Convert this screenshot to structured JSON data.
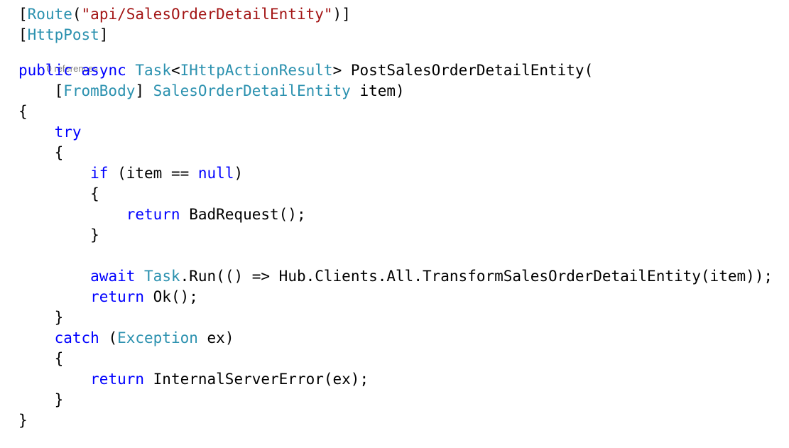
{
  "editor": {
    "language": "csharp",
    "theme": "visual-studio-light",
    "background": "#FFFFFF",
    "colors": {
      "keyword": "#0000FF",
      "type": "#2B91AF",
      "string": "#A31515",
      "plain": "#000000",
      "codelens": "#808080"
    }
  },
  "codelens": {
    "references_label": "0 references"
  },
  "code": {
    "lines": [
      {
        "id": "l1",
        "text": "[Route(\"api/SalesOrderDetailEntity\")]"
      },
      {
        "id": "l2",
        "text": "[HttpPost]"
      },
      {
        "id": "l3",
        "text": "0 references"
      },
      {
        "id": "l4",
        "text": "public async Task<IHttpActionResult> PostSalesOrderDetailEntity("
      },
      {
        "id": "l5",
        "text": "    [FromBody] SalesOrderDetailEntity item)"
      },
      {
        "id": "l6",
        "text": "{"
      },
      {
        "id": "l7",
        "text": "    try"
      },
      {
        "id": "l8",
        "text": "    {"
      },
      {
        "id": "l9",
        "text": "        if (item == null)"
      },
      {
        "id": "l10",
        "text": "        {"
      },
      {
        "id": "l11",
        "text": "            return BadRequest();"
      },
      {
        "id": "l12",
        "text": "        }"
      },
      {
        "id": "l13",
        "text": ""
      },
      {
        "id": "l14",
        "text": "        await Task.Run(() => Hub.Clients.All.TransformSalesOrderDetailEntity(item));"
      },
      {
        "id": "l15",
        "text": "        return Ok();"
      },
      {
        "id": "l16",
        "text": "    }"
      },
      {
        "id": "l17",
        "text": "    catch (Exception ex)"
      },
      {
        "id": "l18",
        "text": "    {"
      },
      {
        "id": "l19",
        "text": "        return InternalServerError(ex);"
      },
      {
        "id": "l20",
        "text": "    }"
      },
      {
        "id": "l21",
        "text": "}"
      }
    ]
  },
  "tokens": {
    "line1": [
      {
        "t": "[",
        "c": "plain"
      },
      {
        "t": "Route",
        "c": "type"
      },
      {
        "t": "(",
        "c": "plain"
      },
      {
        "t": "\"api/SalesOrderDetailEntity\"",
        "c": "str"
      },
      {
        "t": ")]",
        "c": "plain"
      }
    ],
    "line2": [
      {
        "t": "[",
        "c": "plain"
      },
      {
        "t": "HttpPost",
        "c": "type"
      },
      {
        "t": "]",
        "c": "plain"
      }
    ],
    "line4": [
      {
        "t": "public",
        "c": "kw"
      },
      {
        "t": " ",
        "c": "plain"
      },
      {
        "t": "async",
        "c": "kw"
      },
      {
        "t": " ",
        "c": "plain"
      },
      {
        "t": "Task",
        "c": "type"
      },
      {
        "t": "<",
        "c": "plain"
      },
      {
        "t": "IHttpActionResult",
        "c": "type"
      },
      {
        "t": "> PostSalesOrderDetailEntity(",
        "c": "plain"
      }
    ],
    "line5": [
      {
        "t": "    [",
        "c": "plain"
      },
      {
        "t": "FromBody",
        "c": "type"
      },
      {
        "t": "] ",
        "c": "plain"
      },
      {
        "t": "SalesOrderDetailEntity",
        "c": "type"
      },
      {
        "t": " item)",
        "c": "plain"
      }
    ],
    "line6": [
      {
        "t": "{",
        "c": "plain"
      }
    ],
    "line7": [
      {
        "t": "    ",
        "c": "plain"
      },
      {
        "t": "try",
        "c": "kw"
      }
    ],
    "line8": [
      {
        "t": "    {",
        "c": "plain"
      }
    ],
    "line9": [
      {
        "t": "        ",
        "c": "plain"
      },
      {
        "t": "if",
        "c": "kw"
      },
      {
        "t": " (item == ",
        "c": "plain"
      },
      {
        "t": "null",
        "c": "kw"
      },
      {
        "t": ")",
        "c": "plain"
      }
    ],
    "line10": [
      {
        "t": "        {",
        "c": "plain"
      }
    ],
    "line11": [
      {
        "t": "            ",
        "c": "plain"
      },
      {
        "t": "return",
        "c": "kw"
      },
      {
        "t": " BadRequest();",
        "c": "plain"
      }
    ],
    "line12": [
      {
        "t": "        }",
        "c": "plain"
      }
    ],
    "line13": [
      {
        "t": "",
        "c": "plain"
      }
    ],
    "line14": [
      {
        "t": "        ",
        "c": "plain"
      },
      {
        "t": "await",
        "c": "kw"
      },
      {
        "t": " ",
        "c": "plain"
      },
      {
        "t": "Task",
        "c": "type"
      },
      {
        "t": ".Run(() => Hub.Clients.All.TransformSalesOrderDetailEntity(item));",
        "c": "plain"
      }
    ],
    "line15": [
      {
        "t": "        ",
        "c": "plain"
      },
      {
        "t": "return",
        "c": "kw"
      },
      {
        "t": " Ok();",
        "c": "plain"
      }
    ],
    "line16": [
      {
        "t": "    }",
        "c": "plain"
      }
    ],
    "line17": [
      {
        "t": "    ",
        "c": "plain"
      },
      {
        "t": "catch",
        "c": "kw"
      },
      {
        "t": " (",
        "c": "plain"
      },
      {
        "t": "Exception",
        "c": "type"
      },
      {
        "t": " ex)",
        "c": "plain"
      }
    ],
    "line18": [
      {
        "t": "    {",
        "c": "plain"
      }
    ],
    "line19": [
      {
        "t": "        ",
        "c": "plain"
      },
      {
        "t": "return",
        "c": "kw"
      },
      {
        "t": " InternalServerError(ex);",
        "c": "plain"
      }
    ],
    "line20": [
      {
        "t": "    }",
        "c": "plain"
      }
    ],
    "line21": [
      {
        "t": "}",
        "c": "plain"
      }
    ]
  }
}
